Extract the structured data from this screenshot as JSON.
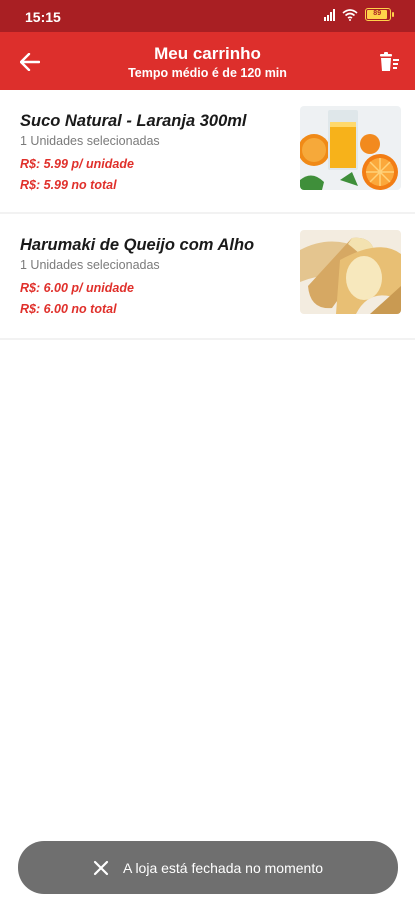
{
  "status_bar": {
    "time": "15:15",
    "battery_level": 0.85,
    "battery_label": "89"
  },
  "header": {
    "title": "Meu carrinho",
    "subtitle": "Tempo médio é de 120 min",
    "back_icon": "arrow-left-icon",
    "clear_icon": "clear-cart-icon"
  },
  "cart": {
    "items": [
      {
        "name": "Suco Natural - Laranja 300ml",
        "quantity_text": "1 Unidades selecionadas",
        "unit_price": "R$: 5.99 p/ unidade",
        "total_price": "R$: 5.99 no total",
        "image": "orange-juice-photo"
      },
      {
        "name": "Harumaki de Queijo com Alho",
        "quantity_text": "1 Unidades selecionadas",
        "unit_price": "R$: 6.00 p/ unidade",
        "total_price": "R$: 6.00 no total",
        "image": "spring-roll-photo"
      }
    ]
  },
  "snackbar": {
    "message": "A loja está fechada no momento",
    "icon": "close-icon"
  },
  "colors": {
    "status_bar": "#a91f23",
    "app_bar": "#dd2f2c",
    "price": "#e0302b",
    "snackbar": "#6f6f6f"
  }
}
